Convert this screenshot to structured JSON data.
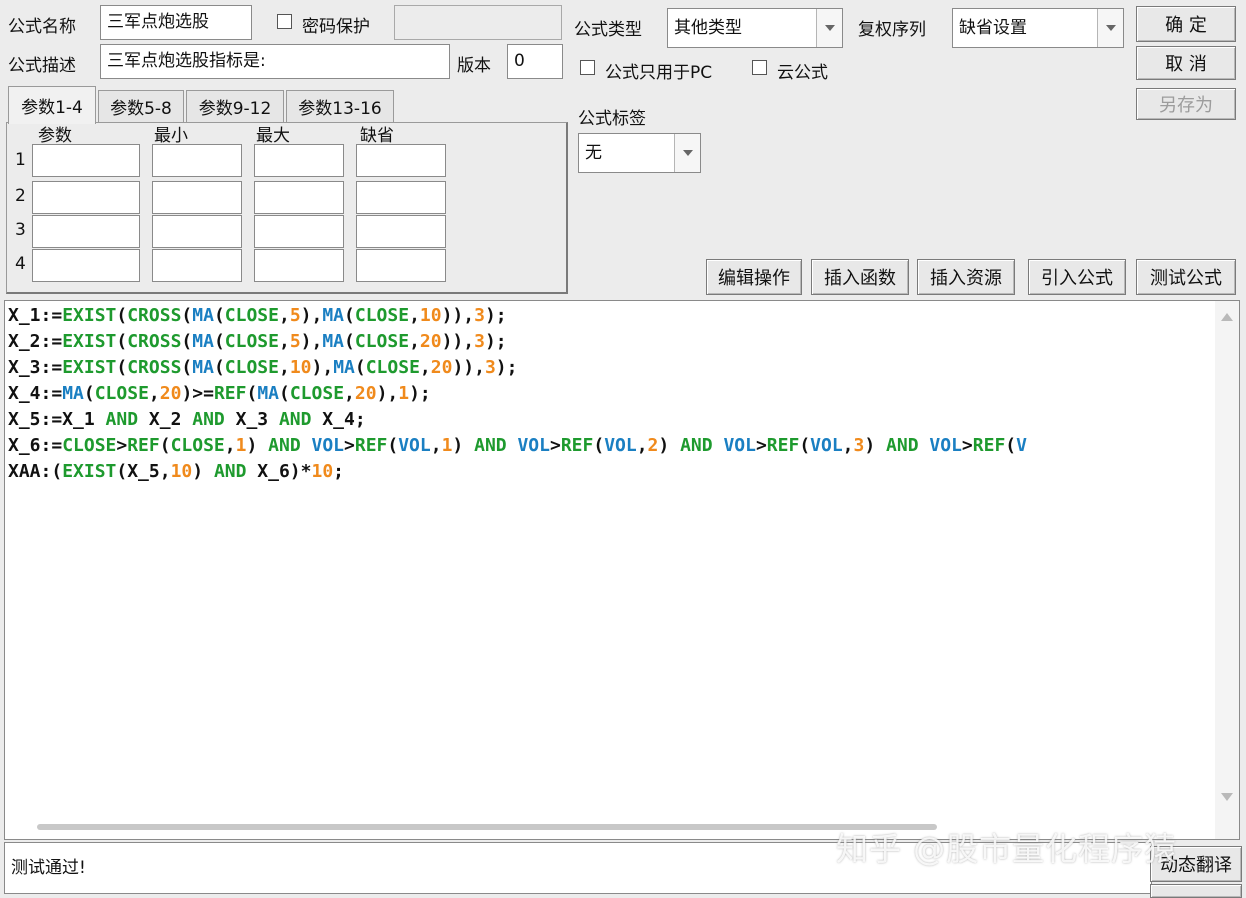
{
  "form": {
    "name_label": "公式名称",
    "name_value": "三军点炮选股",
    "password_label": "密码保护",
    "desc_label": "公式描述",
    "desc_value": "三军点炮选股指标是:",
    "version_label": "版本",
    "version_value": "0",
    "type_label": "公式类型",
    "type_value": "其他类型",
    "rights_label": "复权序列",
    "rights_value": "缺省设置",
    "pc_only_label": "公式只用于PC",
    "cloud_label": "云公式",
    "tag_label": "公式标签",
    "tag_value": "无"
  },
  "buttons": {
    "ok": "确 定",
    "cancel": "取 消",
    "save_as": "另存为",
    "edit_ops": "编辑操作",
    "insert_func": "插入函数",
    "insert_res": "插入资源",
    "import_formula": "引入公式",
    "test_formula": "测试公式",
    "dynamic_translate": "动态翻译"
  },
  "tabs": [
    {
      "label": "参数1-4",
      "active": true
    },
    {
      "label": "参数5-8",
      "active": false
    },
    {
      "label": "参数9-12",
      "active": false
    },
    {
      "label": "参数13-16",
      "active": false
    }
  ],
  "params": {
    "headers": [
      "参数",
      "最小",
      "最大",
      "缺省"
    ],
    "rows": [
      "1",
      "2",
      "3",
      "4"
    ]
  },
  "colors": {
    "text": "#111111",
    "function": "#1e9a2e",
    "variable": "#1a7fc2",
    "number": "#f08a1c",
    "keyword": "#1e9a2e"
  },
  "code": [
    [
      [
        "X_1:=",
        "t"
      ],
      [
        "EXIST",
        "f"
      ],
      [
        "(",
        "t"
      ],
      [
        "CROSS",
        "f"
      ],
      [
        "(",
        "t"
      ],
      [
        "MA",
        "v"
      ],
      [
        "(",
        "t"
      ],
      [
        "CLOSE",
        "f"
      ],
      [
        ",",
        "t"
      ],
      [
        "5",
        "n"
      ],
      [
        "),",
        "t"
      ],
      [
        "MA",
        "v"
      ],
      [
        "(",
        "t"
      ],
      [
        "CLOSE",
        "f"
      ],
      [
        ",",
        "t"
      ],
      [
        "10",
        "n"
      ],
      [
        ")),",
        "t"
      ],
      [
        "3",
        "n"
      ],
      [
        ");",
        "t"
      ]
    ],
    [
      [
        "X_2:=",
        "t"
      ],
      [
        "EXIST",
        "f"
      ],
      [
        "(",
        "t"
      ],
      [
        "CROSS",
        "f"
      ],
      [
        "(",
        "t"
      ],
      [
        "MA",
        "v"
      ],
      [
        "(",
        "t"
      ],
      [
        "CLOSE",
        "f"
      ],
      [
        ",",
        "t"
      ],
      [
        "5",
        "n"
      ],
      [
        "),",
        "t"
      ],
      [
        "MA",
        "v"
      ],
      [
        "(",
        "t"
      ],
      [
        "CLOSE",
        "f"
      ],
      [
        ",",
        "t"
      ],
      [
        "20",
        "n"
      ],
      [
        ")),",
        "t"
      ],
      [
        "3",
        "n"
      ],
      [
        ");",
        "t"
      ]
    ],
    [
      [
        "X_3:=",
        "t"
      ],
      [
        "EXIST",
        "f"
      ],
      [
        "(",
        "t"
      ],
      [
        "CROSS",
        "f"
      ],
      [
        "(",
        "t"
      ],
      [
        "MA",
        "v"
      ],
      [
        "(",
        "t"
      ],
      [
        "CLOSE",
        "f"
      ],
      [
        ",",
        "t"
      ],
      [
        "10",
        "n"
      ],
      [
        "),",
        "t"
      ],
      [
        "MA",
        "v"
      ],
      [
        "(",
        "t"
      ],
      [
        "CLOSE",
        "f"
      ],
      [
        ",",
        "t"
      ],
      [
        "20",
        "n"
      ],
      [
        ")),",
        "t"
      ],
      [
        "3",
        "n"
      ],
      [
        ");",
        "t"
      ]
    ],
    [
      [
        "X_4:=",
        "t"
      ],
      [
        "MA",
        "v"
      ],
      [
        "(",
        "t"
      ],
      [
        "CLOSE",
        "f"
      ],
      [
        ",",
        "t"
      ],
      [
        "20",
        "n"
      ],
      [
        ")>=",
        "t"
      ],
      [
        "REF",
        "f"
      ],
      [
        "(",
        "t"
      ],
      [
        "MA",
        "v"
      ],
      [
        "(",
        "t"
      ],
      [
        "CLOSE",
        "f"
      ],
      [
        ",",
        "t"
      ],
      [
        "20",
        "n"
      ],
      [
        "),",
        "t"
      ],
      [
        "1",
        "n"
      ],
      [
        ");",
        "t"
      ]
    ],
    [
      [
        "X_5:=X_1 ",
        "t"
      ],
      [
        "AND",
        "f"
      ],
      [
        " X_2 ",
        "t"
      ],
      [
        "AND",
        "f"
      ],
      [
        " X_3 ",
        "t"
      ],
      [
        "AND",
        "f"
      ],
      [
        " X_4;",
        "t"
      ]
    ],
    [
      [
        "X_6:=",
        "t"
      ],
      [
        "CLOSE",
        "f"
      ],
      [
        ">",
        "t"
      ],
      [
        "REF",
        "f"
      ],
      [
        "(",
        "t"
      ],
      [
        "CLOSE",
        "f"
      ],
      [
        ",",
        "t"
      ],
      [
        "1",
        "n"
      ],
      [
        ") ",
        "t"
      ],
      [
        "AND",
        "f"
      ],
      [
        " ",
        "t"
      ],
      [
        "VOL",
        "v"
      ],
      [
        ">",
        "t"
      ],
      [
        "REF",
        "f"
      ],
      [
        "(",
        "t"
      ],
      [
        "VOL",
        "v"
      ],
      [
        ",",
        "t"
      ],
      [
        "1",
        "n"
      ],
      [
        ") ",
        "t"
      ],
      [
        "AND",
        "f"
      ],
      [
        " ",
        "t"
      ],
      [
        "VOL",
        "v"
      ],
      [
        ">",
        "t"
      ],
      [
        "REF",
        "f"
      ],
      [
        "(",
        "t"
      ],
      [
        "VOL",
        "v"
      ],
      [
        ",",
        "t"
      ],
      [
        "2",
        "n"
      ],
      [
        ") ",
        "t"
      ],
      [
        "AND",
        "f"
      ],
      [
        " ",
        "t"
      ],
      [
        "VOL",
        "v"
      ],
      [
        ">",
        "t"
      ],
      [
        "REF",
        "f"
      ],
      [
        "(",
        "t"
      ],
      [
        "VOL",
        "v"
      ],
      [
        ",",
        "t"
      ],
      [
        "3",
        "n"
      ],
      [
        ") ",
        "t"
      ],
      [
        "AND",
        "f"
      ],
      [
        " ",
        "t"
      ],
      [
        "VOL",
        "v"
      ],
      [
        ">",
        "t"
      ],
      [
        "REF",
        "f"
      ],
      [
        "(",
        "t"
      ],
      [
        "V",
        "v"
      ]
    ],
    [
      [
        "XAA:(",
        "t"
      ],
      [
        "EXIST",
        "f"
      ],
      [
        "(X_5,",
        "t"
      ],
      [
        "10",
        "n"
      ],
      [
        ") ",
        "t"
      ],
      [
        "AND",
        "f"
      ],
      [
        " X_6)*",
        "t"
      ],
      [
        "10",
        "n"
      ],
      [
        ";",
        "t"
      ]
    ]
  ],
  "status": {
    "message": "测试通过!"
  },
  "watermark": "知乎 @股市量化程序猿"
}
